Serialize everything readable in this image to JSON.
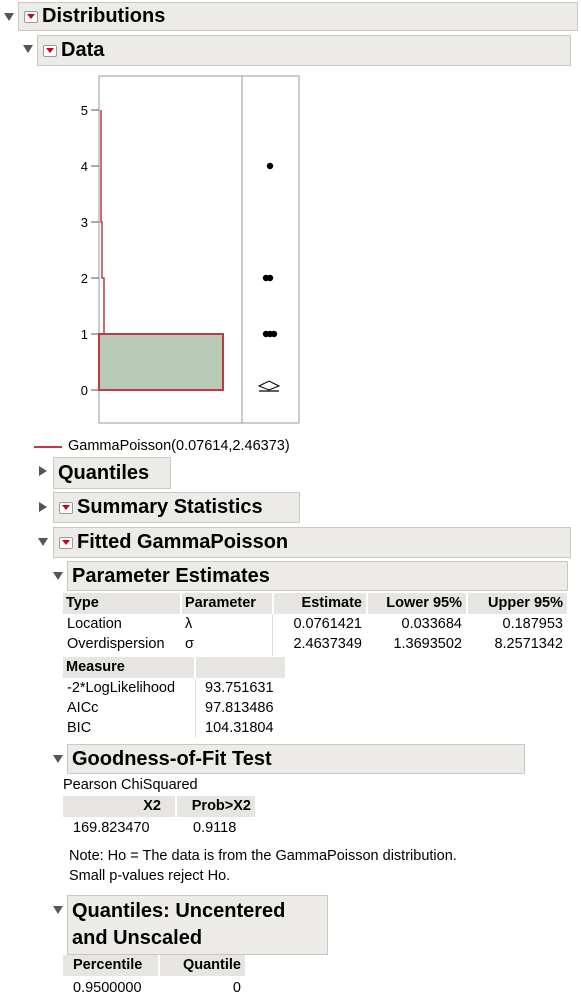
{
  "sections": {
    "distributions": "Distributions",
    "data": "Data",
    "quantiles": "Quantiles",
    "summary_statistics": "Summary Statistics",
    "fitted": "Fitted GammaPoisson",
    "param_estimates": "Parameter Estimates",
    "gof": "Goodness-of-Fit Test",
    "quantiles_unc_line1": "Quantiles: Uncentered",
    "quantiles_unc_line2": "and Unscaled"
  },
  "legend": {
    "label": "GammaPoisson(0.07614,2.46373)",
    "color": "#c0394b"
  },
  "chart_data": {
    "type": "bar",
    "orientation": "horizontal-histogram",
    "y_ticks": [
      "0",
      "1",
      "2",
      "3",
      "4",
      "5"
    ],
    "ylim": [
      0,
      5.4
    ],
    "histogram": [
      {
        "from": 0,
        "to": 1,
        "count_fraction": 1.0
      }
    ],
    "fitted_curve_color": "#c0394b",
    "bar_fill": "#b6cab5",
    "points": [
      0,
      0,
      1,
      1,
      1,
      2,
      2,
      4
    ],
    "points_note_values": [
      1,
      2,
      4
    ]
  },
  "param_table": {
    "headers": [
      "Type",
      "Parameter",
      "Estimate",
      "Lower 95%",
      "Upper 95%"
    ],
    "rows": [
      [
        "Location",
        "λ",
        "0.0761421",
        "0.033684",
        "0.187953"
      ],
      [
        "Overdispersion",
        "σ",
        "2.4637349",
        "1.3693502",
        "8.2571342"
      ]
    ]
  },
  "measure_table": {
    "header": "Measure",
    "rows": [
      [
        "-2*LogLikelihood",
        "93.751631"
      ],
      [
        "AICc",
        "97.813486"
      ],
      [
        "BIC",
        "104.31804"
      ]
    ]
  },
  "gof": {
    "test_name": "Pearson ChiSquared",
    "headers": [
      "X2",
      "Prob>X2"
    ],
    "values": [
      "169.823470",
      "0.9118"
    ],
    "note_line1": "Note: Ho = The data is from the GammaPoisson distribution.",
    "note_line2": "Small p-values reject Ho."
  },
  "quantile_table": {
    "headers": [
      "Percentile",
      "Quantile"
    ],
    "rows": [
      [
        "0.9500000",
        "0"
      ]
    ]
  }
}
